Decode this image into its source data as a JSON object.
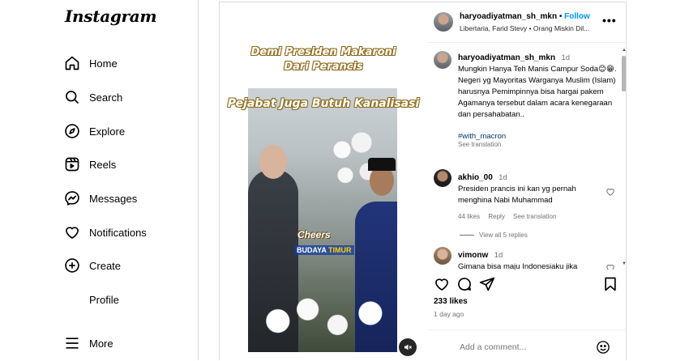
{
  "app": {
    "logo": "Instagram"
  },
  "sidebar": {
    "items": [
      {
        "label": "Home",
        "icon": "home-icon"
      },
      {
        "label": "Search",
        "icon": "search-icon"
      },
      {
        "label": "Explore",
        "icon": "compass-icon"
      },
      {
        "label": "Reels",
        "icon": "reels-icon"
      },
      {
        "label": "Messages",
        "icon": "messenger-icon"
      },
      {
        "label": "Notifications",
        "icon": "heart-icon"
      },
      {
        "label": "Create",
        "icon": "plus-square-icon"
      },
      {
        "label": "Profile",
        "icon": "avatar"
      }
    ],
    "more": {
      "label": "More",
      "icon": "hamburger-icon"
    }
  },
  "post": {
    "overlay": {
      "line1": "Demi Presiden Makaroni",
      "line2": "Dari Perancis",
      "line3": "Pejabat Juga Butuh Kanalisasi",
      "cheers": "Cheers",
      "budaya": "BUDAYA",
      "timur": "TIMUR"
    },
    "header": {
      "username": "haryoadiyatman_sh_mkn",
      "separator": "•",
      "follow": "Follow",
      "subtitle": "Libertaria, Farid Stevy • Orang Miskin Dil..."
    },
    "caption": {
      "username": "haryoadiyatman_sh_mkn",
      "time": "1d",
      "text": "Mungkin Hanya Teh Manis Campur Soda😊😁. Negeri yg Mayoritas Warganya Muslim (Islam) harusnya Pemimpinnya bisa hargai pakem Agamanya tersebut dalam acara kenegaraan dan persahabatan..",
      "hashtag": "#with_macron",
      "see_translation": "See translation"
    },
    "comments": [
      {
        "username": "akhio_00",
        "time": "1d",
        "text": "Presiden prancis ini kan yg pernah menghina Nabi Muhammad",
        "likes": "44 likes",
        "reply": "Reply",
        "see_translation": "See translation",
        "view_replies": "View all 5 replies"
      },
      {
        "username": "vimonw",
        "time": "1d",
        "text": "Gimana bisa maju Indonesiaku jika"
      }
    ],
    "likes": "233 likes",
    "time_ago": "1 day ago",
    "add_comment_placeholder": "Add a comment..."
  },
  "colors": {
    "link_blue": "#0095f6",
    "hashtag": "#00376b",
    "border": "#dbdbdb"
  }
}
